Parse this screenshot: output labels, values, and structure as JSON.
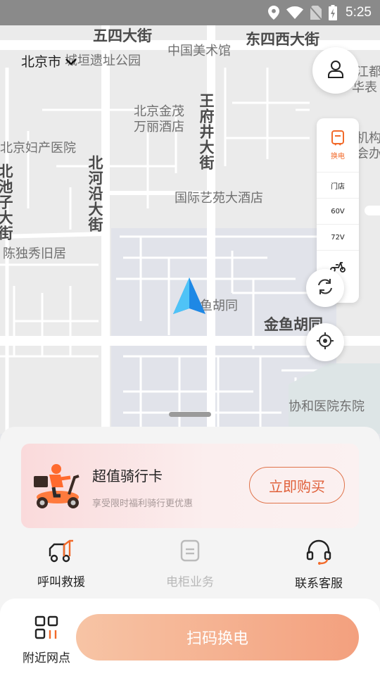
{
  "status_bar": {
    "time": "5:25"
  },
  "map": {
    "city": "北京市",
    "labels": [
      {
        "text": "五四大街",
        "style": "big"
      },
      {
        "text": "东四西大街",
        "style": "big"
      },
      {
        "text": "中国美术馆"
      },
      {
        "text": "城垣遗址公园"
      },
      {
        "text": "北京金茂"
      },
      {
        "text": "万丽酒店"
      },
      {
        "text": "王府井大街",
        "style": "big-vert"
      },
      {
        "text": "北京妇产医院"
      },
      {
        "text": "北河沿大街",
        "style": "big-vert"
      },
      {
        "text": "北池子大街",
        "style": "big-vert"
      },
      {
        "text": "国际艺苑大酒店"
      },
      {
        "text": "陈独秀旧居"
      },
      {
        "text": "金鱼胡同",
        "style": "big"
      },
      {
        "text": "鱼胡同"
      },
      {
        "text": "协和医院东院"
      },
      {
        "text": "江都"
      },
      {
        "text": "华表"
      },
      {
        "text": "机构编"
      },
      {
        "text": "会办公"
      }
    ],
    "filters": {
      "swap_label": "换电",
      "items": [
        "门店",
        "60V",
        "72V"
      ]
    }
  },
  "promo": {
    "title": "超值骑行卡",
    "subtitle": "享受限时福利骑行更优惠",
    "button": "立即购买"
  },
  "quick_actions": [
    {
      "label": "呼叫救援",
      "enabled": true
    },
    {
      "label": "电柜业务",
      "enabled": false
    },
    {
      "label": "联系客服",
      "enabled": true
    }
  ],
  "bottom": {
    "nearby_label": "附近网点",
    "scan_button": "扫码换电"
  },
  "colors": {
    "accent": "#f26a2a",
    "scan_button": "#f3a07e"
  }
}
